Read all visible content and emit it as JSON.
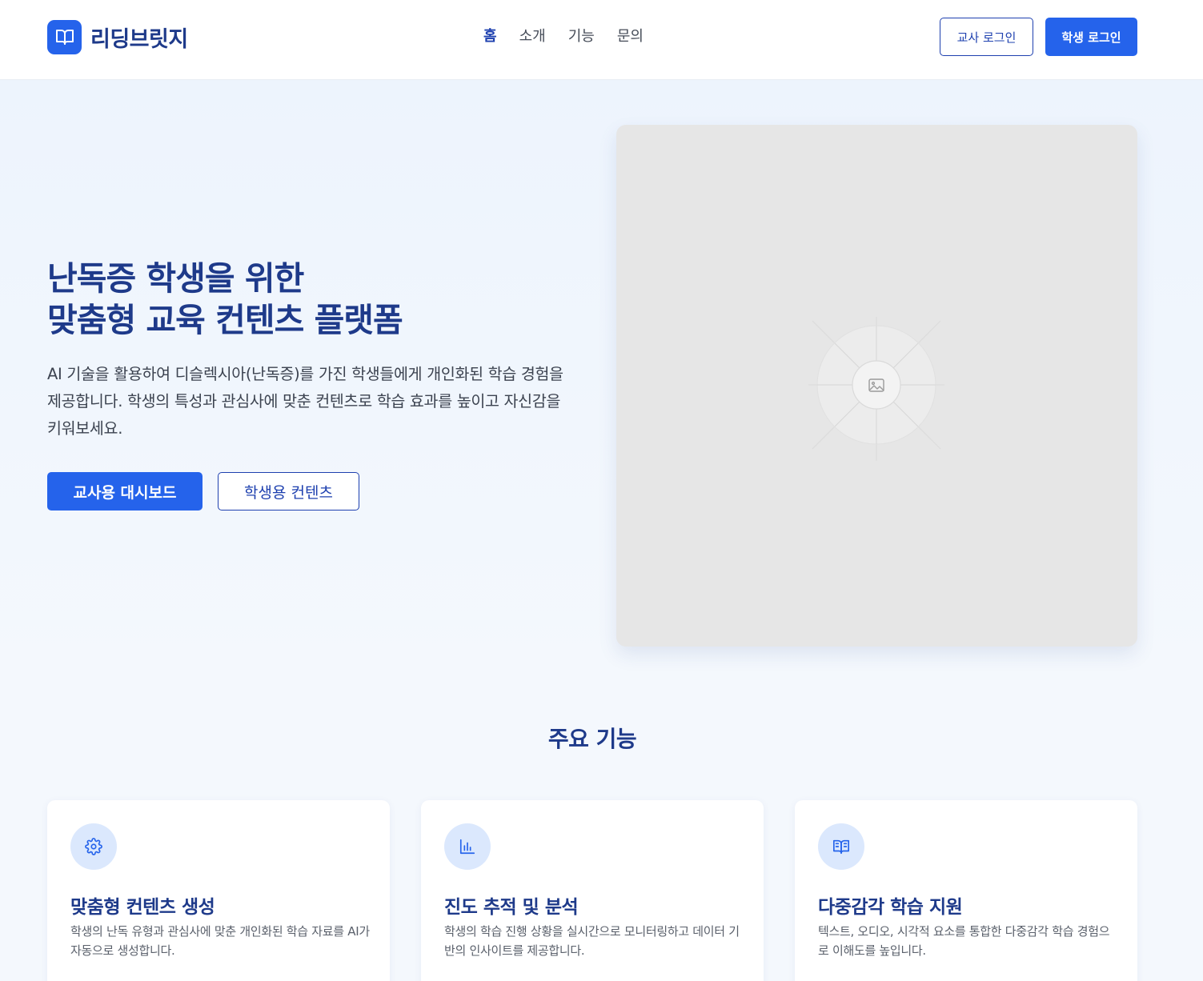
{
  "header": {
    "logo_text": "리딩브릿지",
    "nav": [
      {
        "label": "홈",
        "active": true
      },
      {
        "label": "소개",
        "active": false
      },
      {
        "label": "기능",
        "active": false
      },
      {
        "label": "문의",
        "active": false
      }
    ],
    "teacher_login": "교사 로그인",
    "student_login": "학생 로그인"
  },
  "hero": {
    "title_line1": "난독증 학생을 위한",
    "title_line2": "맞춤형 교육 컨텐츠 플랫폼",
    "description": "AI 기술을 활용하여 디슬렉시아(난독증)를 가진 학생들에게 개인화된 학습 경험을 제공합니다. 학생의 특성과 관심사에 맞춘 컨텐츠로 학습 효과를 높이고 자신감을 키워보세요.",
    "primary_button": "교사용 대시보드",
    "secondary_button": "학생용 컨텐츠",
    "image_icon": "image-placeholder-icon"
  },
  "features": {
    "title": "주요 기능",
    "cards": [
      {
        "icon": "gear-icon",
        "title": "맞춤형 컨텐츠 생성",
        "description": "학생의 난독 유형과 관심사에 맞춘 개인화된 학습 자료를 AI가 자동으로 생성합니다."
      },
      {
        "icon": "bar-chart-icon",
        "title": "진도 추적 및 분석",
        "description": "학생의 학습 진행 상황을 실시간으로 모니터링하고 데이터 기반의 인사이트를 제공합니다."
      },
      {
        "icon": "book-open-icon",
        "title": "다중감각 학습 지원",
        "description": "텍스트, 오디오, 시각적 요소를 통합한 다중감각 학습 경험으로 이해도를 높입니다."
      }
    ]
  },
  "colors": {
    "primary": "#2563eb",
    "heading": "#1e3a8a",
    "background": "#f4f8fd"
  }
}
